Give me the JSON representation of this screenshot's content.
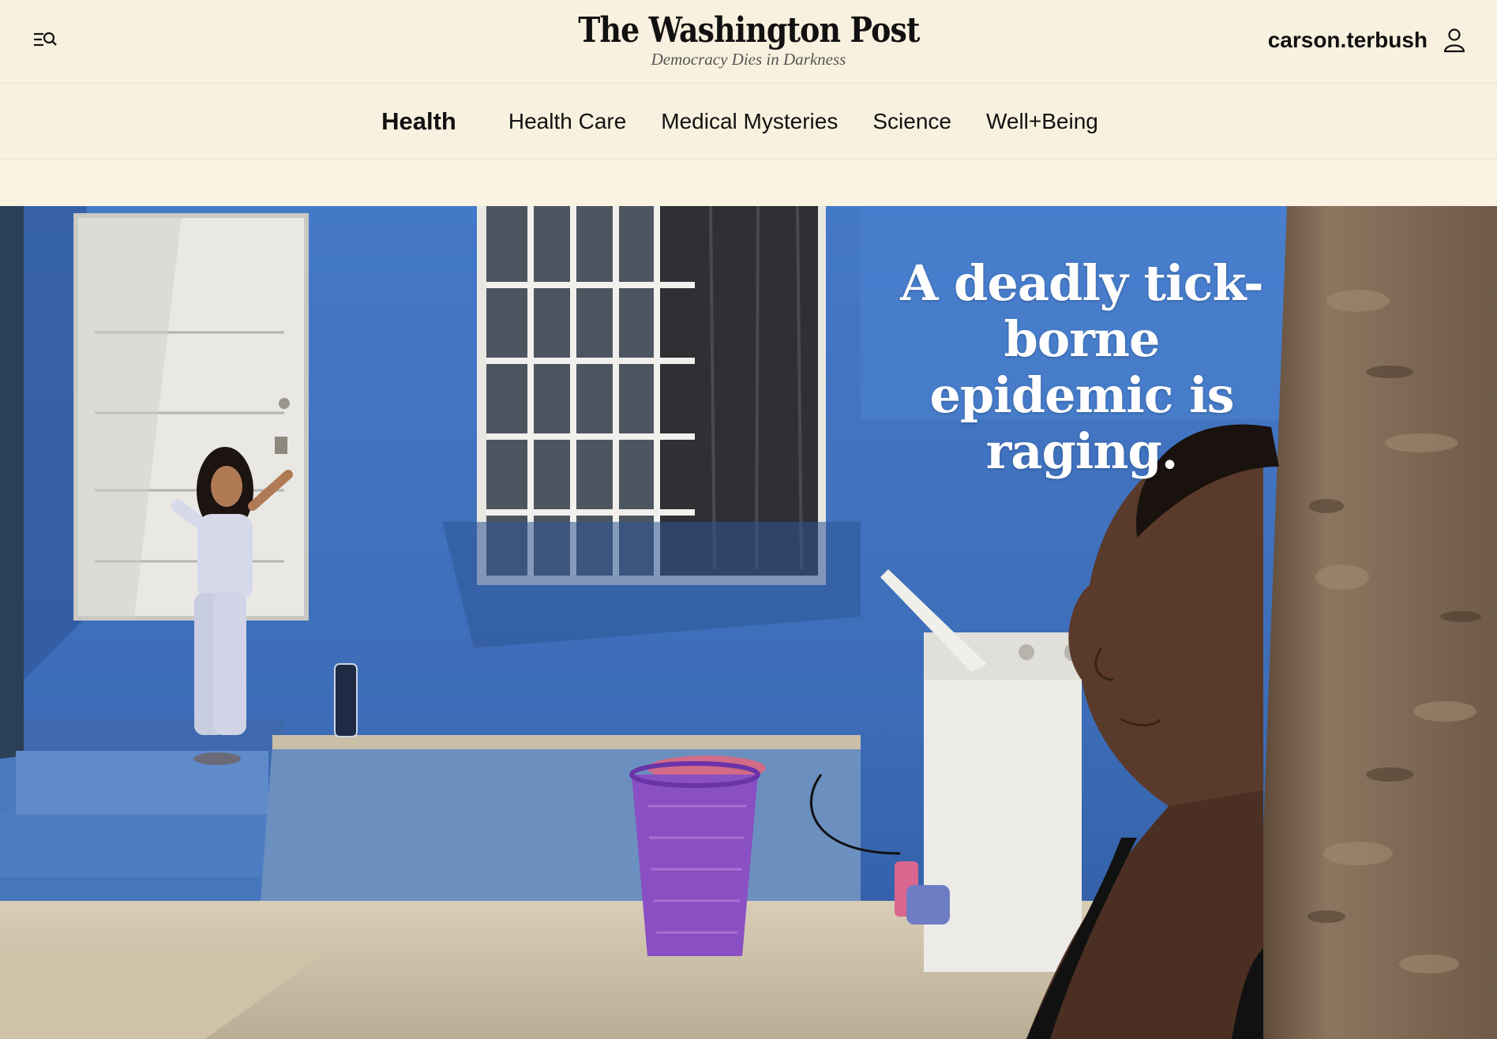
{
  "masthead": {
    "logo_text": "The Washington Post",
    "tagline": "Democracy Dies in Darkness",
    "username": "carson.terbush",
    "menu_icon": "menu-search-icon",
    "account_icon": "user-icon"
  },
  "section_nav": {
    "current": "Health",
    "links": [
      "Health Care",
      "Medical Mysteries",
      "Science",
      "Well+Being"
    ]
  },
  "hero": {
    "headline": "A deadly tick-borne epidemic is raging.",
    "colors": {
      "wall": "#3f73bf",
      "headline": "#ffffff"
    }
  }
}
